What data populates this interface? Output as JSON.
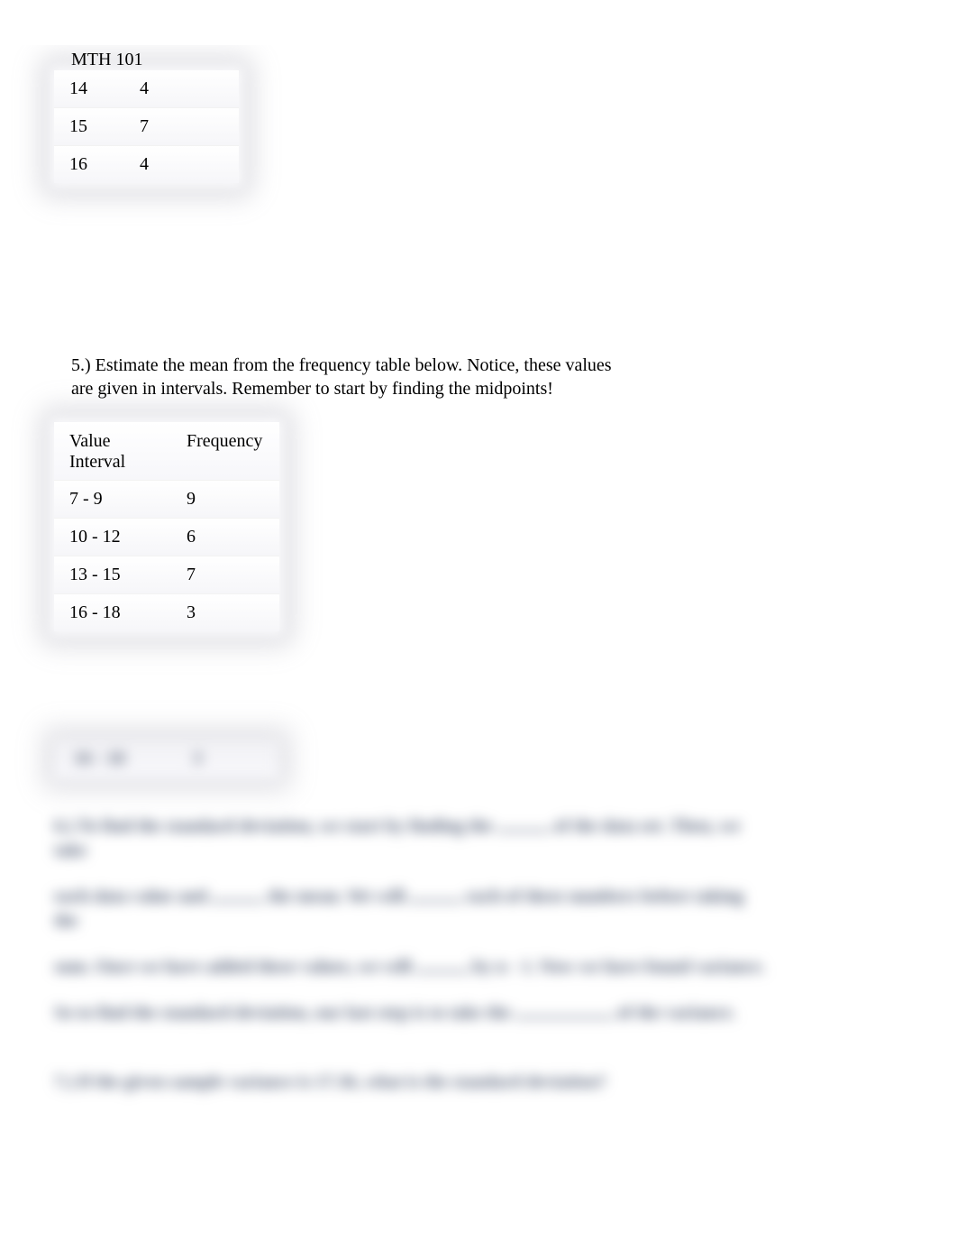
{
  "header": {
    "course": "MTH 101"
  },
  "table1": {
    "rows": [
      {
        "value": "14",
        "frequency": "4"
      },
      {
        "value": "15",
        "frequency": "7"
      },
      {
        "value": "16",
        "frequency": "4"
      }
    ]
  },
  "question5": {
    "text": "5.) Estimate the mean from the frequency table below. Notice, these values are given in intervals. Remember to start by finding the midpoints!"
  },
  "table2": {
    "headers": {
      "col1": "Value Interval",
      "col2": "Frequency"
    },
    "rows": [
      {
        "interval": "7 - 9",
        "frequency": "9"
      },
      {
        "interval": "10 - 12",
        "frequency": "6"
      },
      {
        "interval": "13 - 15",
        "frequency": "7"
      },
      {
        "interval": "16 - 18",
        "frequency": "3"
      }
    ]
  },
  "blurred": {
    "table_row": {
      "a": "16 - 18",
      "b": "3"
    },
    "p1a": "6.) To find the standard deviation, we start by finding the",
    "p1b": "of the data set. Then, we take",
    "p2a": "each data value and",
    "p2b": "the mean. We will",
    "p2c": "each of these numbers before taking the",
    "p3a": "sum. Once we have added these values, we will",
    "p3b": "by n - 1. Now we have found variance.",
    "p4a": "So to find the standard deviation, our last step is to take the",
    "p4b": "of the variance.",
    "p5": "7.) If the given sample variance is 17.36, what is the standard deviation?"
  }
}
